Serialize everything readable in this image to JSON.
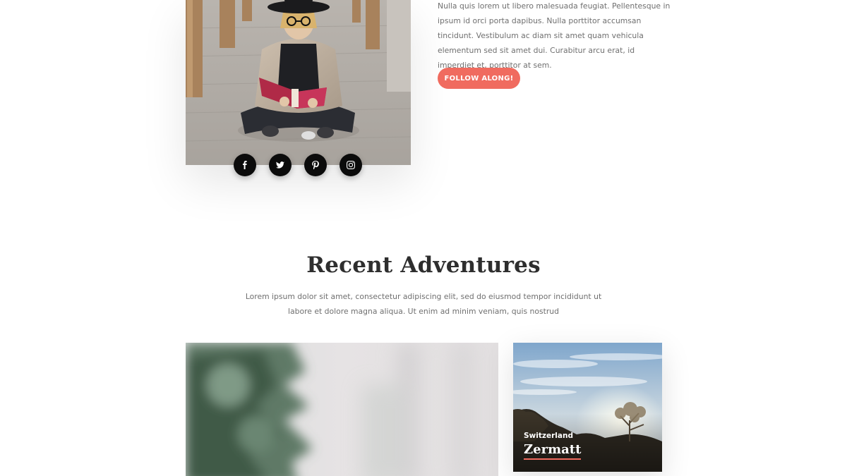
{
  "about": {
    "paragraph": "Nulla quis lorem ut libero malesuada feugiat. Pellentesque in ipsum id orci porta dapibus. Nulla porttitor accumsan tincidunt. Vestibulum ac diam sit amet quam vehicula elementum sed sit amet dui. Curabitur arcu erat, id imperdiet et, porttitor at sem.",
    "follow_label": "FOLLOW ALONG!",
    "social_icons": [
      "facebook-icon",
      "twitter-icon",
      "pinterest-icon",
      "instagram-icon"
    ]
  },
  "adventures": {
    "title": "Recent Adventures",
    "description": "Lorem ipsum dolor sit amet, consectetur adipiscing elit, sed do eiusmod tempor incididunt ut labore et dolore magna aliqua. Ut enim ad minim veniam, quis nostrud",
    "cards": [
      {
        "location": "Switzerland",
        "name": "Zermatt"
      }
    ]
  },
  "colors": {
    "accent": "#f06b5f",
    "heading": "#2e2e2e",
    "body_text": "#6f6f6f",
    "social_bg": "#0b0b0b"
  }
}
